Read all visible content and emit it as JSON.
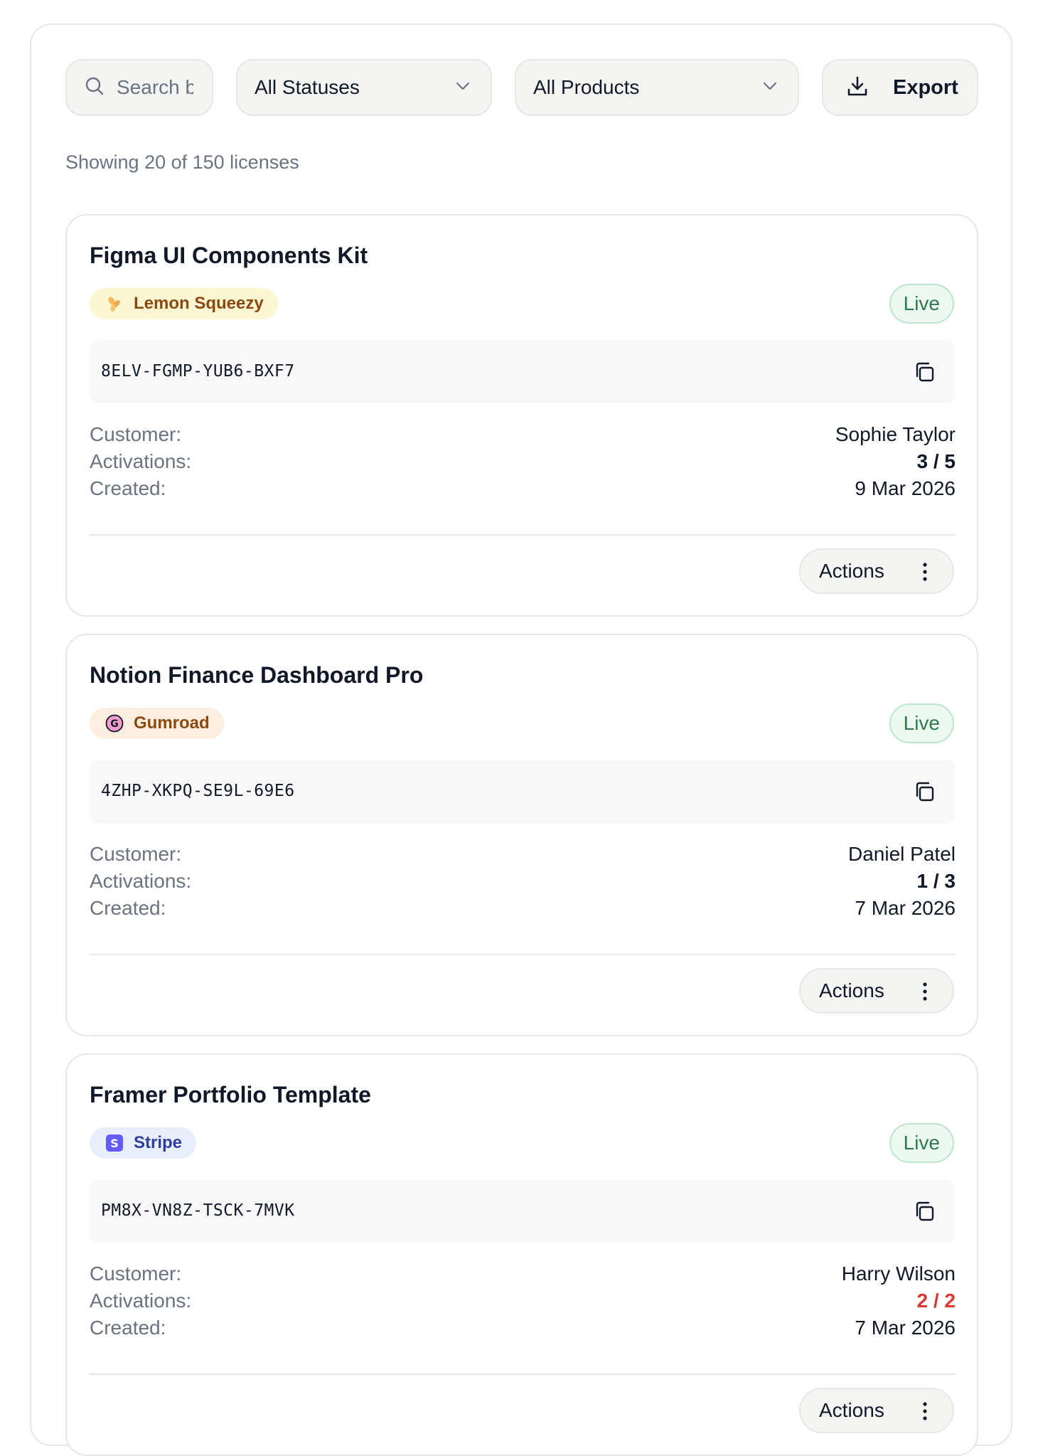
{
  "toolbar": {
    "search_placeholder": "Search b",
    "status_filter": "All Statuses",
    "product_filter": "All Products",
    "export_label": "Export"
  },
  "summary": "Showing 20 of 150 licenses",
  "labels": {
    "customer": "Customer:",
    "activations": "Activations:",
    "created": "Created:",
    "actions": "Actions"
  },
  "licenses": [
    {
      "product": "Figma UI Components Kit",
      "source": "Lemon Squeezy",
      "status": "Live",
      "key": "8ELV-FGMP-YUB6-BXF7",
      "customer": "Sophie Taylor",
      "activations": "3 / 5",
      "created": "9 Mar 2026"
    },
    {
      "product": "Notion Finance Dashboard Pro",
      "source": "Gumroad",
      "status": "Live",
      "key": "4ZHP-XKPQ-SE9L-69E6",
      "customer": "Daniel Patel",
      "activations": "1 / 3",
      "created": "7 Mar 2026"
    },
    {
      "product": "Framer Portfolio Template",
      "source": "Stripe",
      "status": "Live",
      "key": "PM8X-VN8Z-TSCK-7MVK",
      "customer": "Harry Wilson",
      "activations": "2 / 2",
      "created": "7 Mar 2026"
    }
  ],
  "colors": {
    "live_text": "#2f7a4c",
    "activations_full": "#dc3a2e",
    "lemon_squeezy_bg": "#fdf6d3",
    "gumroad_bg": "#fdeee0",
    "stripe_bg": "#e8eefc"
  }
}
